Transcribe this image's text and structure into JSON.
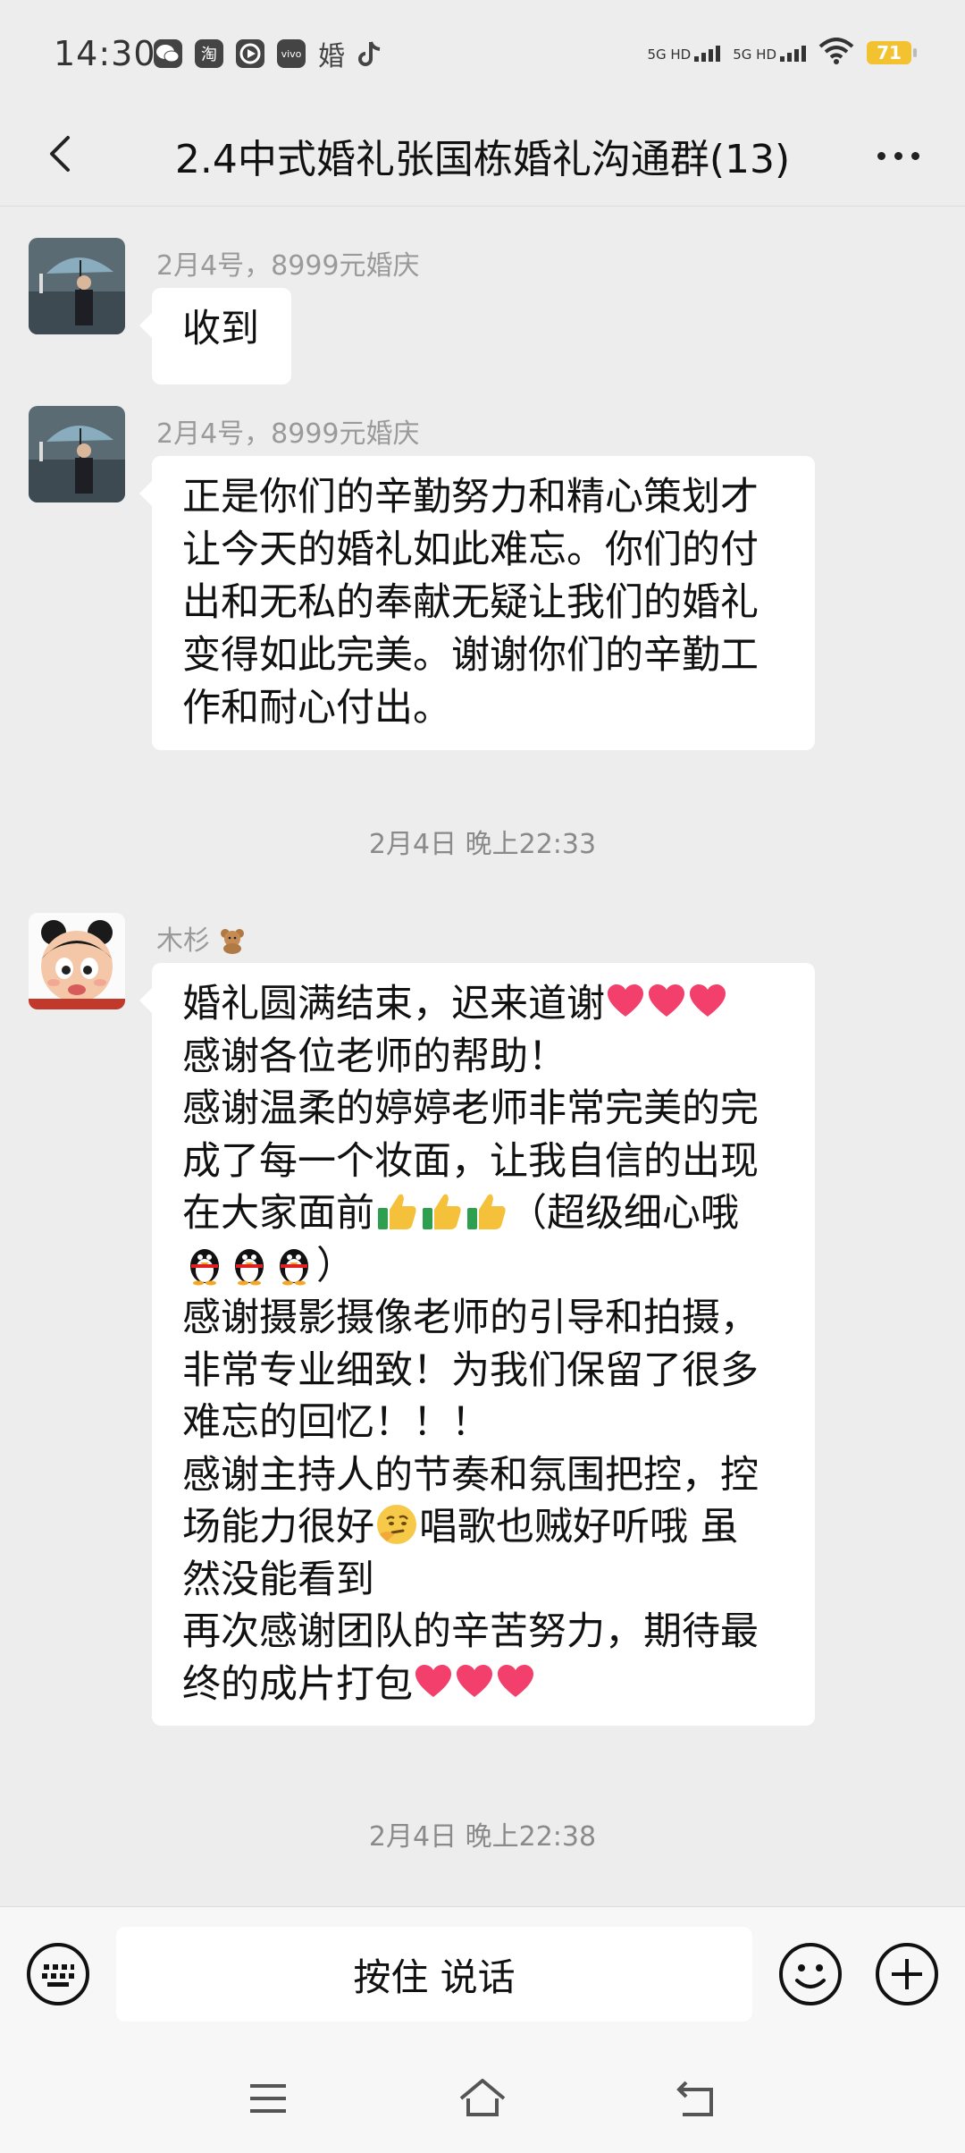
{
  "status": {
    "time": "14:30",
    "app_icons": [
      "wechat-icon",
      "taobao-icon",
      "video-icon",
      "vivo-icon",
      "婚",
      "tiktok-icon"
    ],
    "taobao_glyph": "淘",
    "vivo_glyph": "vivo",
    "network1": "5G HD",
    "network2": "5G HD",
    "battery": "71"
  },
  "nav": {
    "title": "2.4中式婚礼张国栋婚礼沟通群(13)"
  },
  "messages": [
    {
      "sender": "2月4号，8999元婚庆",
      "lines": [
        "收到"
      ]
    },
    {
      "sender": "2月4号，8999元婚庆",
      "lines": [
        "正是你们的辛勤努力和精心策划才",
        "让今天的婚礼如此难忘。你们的付",
        "出和无私的奉献无疑让我们的婚礼",
        "变得如此完美。谢谢你们的辛勤工",
        "作和耐心付出。"
      ]
    },
    {
      "timestamp": "2月4日 晚上22:33"
    },
    {
      "sender": "木杉",
      "lines": [
        "婚礼圆满结束，迟来道谢",
        "感谢各位老师的帮助！",
        "感谢温柔的婷婷老师非常完美的完",
        "成了每一个妆面，让我自信的出现",
        "在大家面前",
        "（超级细心哦",
        "）",
        "感谢摄影摄像老师的引导和拍摄，",
        "非常专业细致！为我们保留了很多",
        "难忘的回忆！！！",
        "感谢主持人的节奏和氛围把控，控",
        "场能力很好",
        "唱歌也贼好听哦  虽",
        "然没能看到",
        "再次感谢团队的辛苦努力，期待最",
        "终的成片打包"
      ]
    },
    {
      "timestamp": "2月4日 晚上22:38"
    }
  ],
  "input": {
    "talk_label": "按住 说话"
  }
}
